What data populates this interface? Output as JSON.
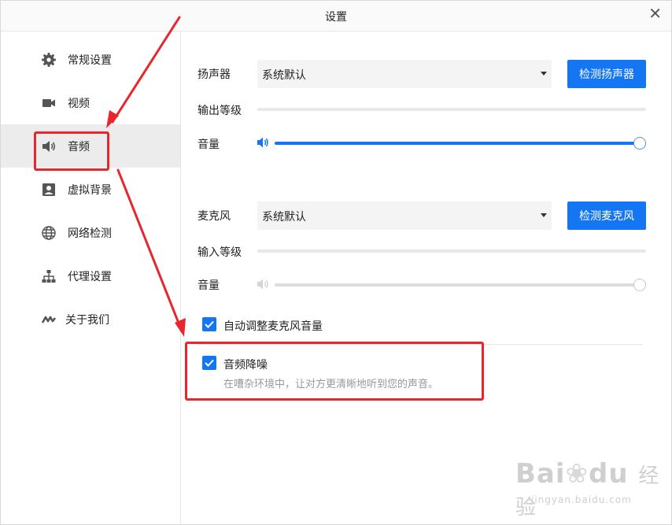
{
  "window": {
    "title": "设置"
  },
  "sidebar": {
    "items": [
      {
        "label": "常规设置",
        "icon": "gear-icon"
      },
      {
        "label": "视频",
        "icon": "video-camera-icon"
      },
      {
        "label": "音频",
        "icon": "speaker-icon"
      },
      {
        "label": "虚拟背景",
        "icon": "portrait-icon"
      },
      {
        "label": "网络检测",
        "icon": "globe-icon"
      },
      {
        "label": "代理设置",
        "icon": "network-tree-icon"
      },
      {
        "label": "关于我们",
        "icon": "logo-icon"
      }
    ],
    "active_index": 2
  },
  "speaker": {
    "label": "扬声器",
    "device": "系统默认",
    "test_button": "检测扬声器",
    "output_level_label": "输出等级",
    "output_level": 0,
    "volume_label": "音量",
    "volume": 1.0
  },
  "microphone": {
    "label": "麦克风",
    "device": "系统默认",
    "test_button": "检测麦克风",
    "input_level_label": "输入等级",
    "input_level": 0,
    "volume_label": "音量",
    "volume": 1.0
  },
  "options": {
    "auto_adjust": {
      "label": "自动调整麦克风音量",
      "checked": true
    },
    "noise_reduction": {
      "label": "音频降噪",
      "checked": true,
      "description": "在嘈杂环境中，让对方更清晰地听到您的声音。"
    }
  },
  "watermark": {
    "brand": "Bai",
    "brand2": "du",
    "cn": "经验",
    "url": "jingyan.baidu.com"
  },
  "colors": {
    "accent": "#1476f2",
    "annotation": "#e8262b",
    "active_bg": "#ececec"
  }
}
